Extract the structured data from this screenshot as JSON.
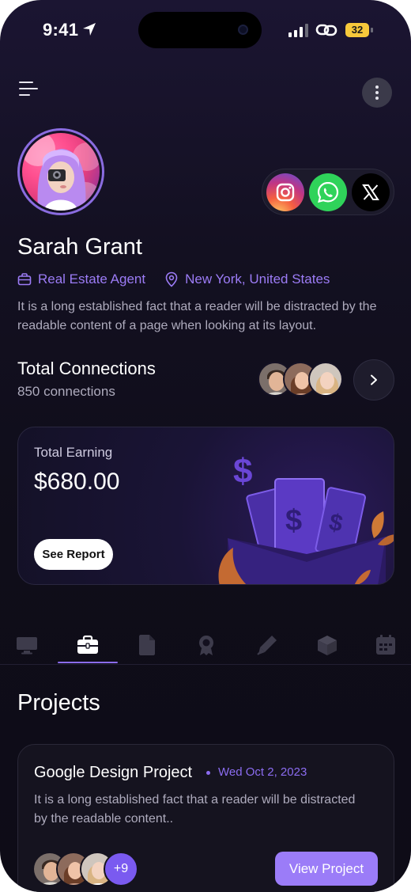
{
  "status_bar": {
    "time": "9:41",
    "battery": "32"
  },
  "profile": {
    "name": "Sarah Grant",
    "role": "Real Estate Agent",
    "location": "New York, United States",
    "bio": "It is a long established fact that a reader will be distracted by the readable content of a page when looking at its layout."
  },
  "socials": [
    "instagram-icon",
    "whatsapp-icon",
    "x-icon"
  ],
  "connections": {
    "title": "Total Connections",
    "count": "850 connections"
  },
  "earning": {
    "label": "Total Earning",
    "amount": "$680.00",
    "report_label": "See Report"
  },
  "tabs": [
    {
      "icon": "monitor-icon",
      "active": false
    },
    {
      "icon": "briefcase-icon",
      "active": true
    },
    {
      "icon": "document-icon",
      "active": false
    },
    {
      "icon": "award-icon",
      "active": false
    },
    {
      "icon": "pen-icon",
      "active": false
    },
    {
      "icon": "box-icon",
      "active": false
    },
    {
      "icon": "calendar-icon",
      "active": false
    }
  ],
  "projects": {
    "title": "Projects",
    "items": [
      {
        "name": "Google Design Project",
        "date": "Wed Oct 2, 2023",
        "description": "It is a long established fact that a reader will be distracted by the readable content..",
        "members_more": "+9",
        "view_label": "View Project"
      }
    ]
  },
  "colors": {
    "accent": "#9b7cf8",
    "background": "#131021",
    "card": "#15131f"
  }
}
